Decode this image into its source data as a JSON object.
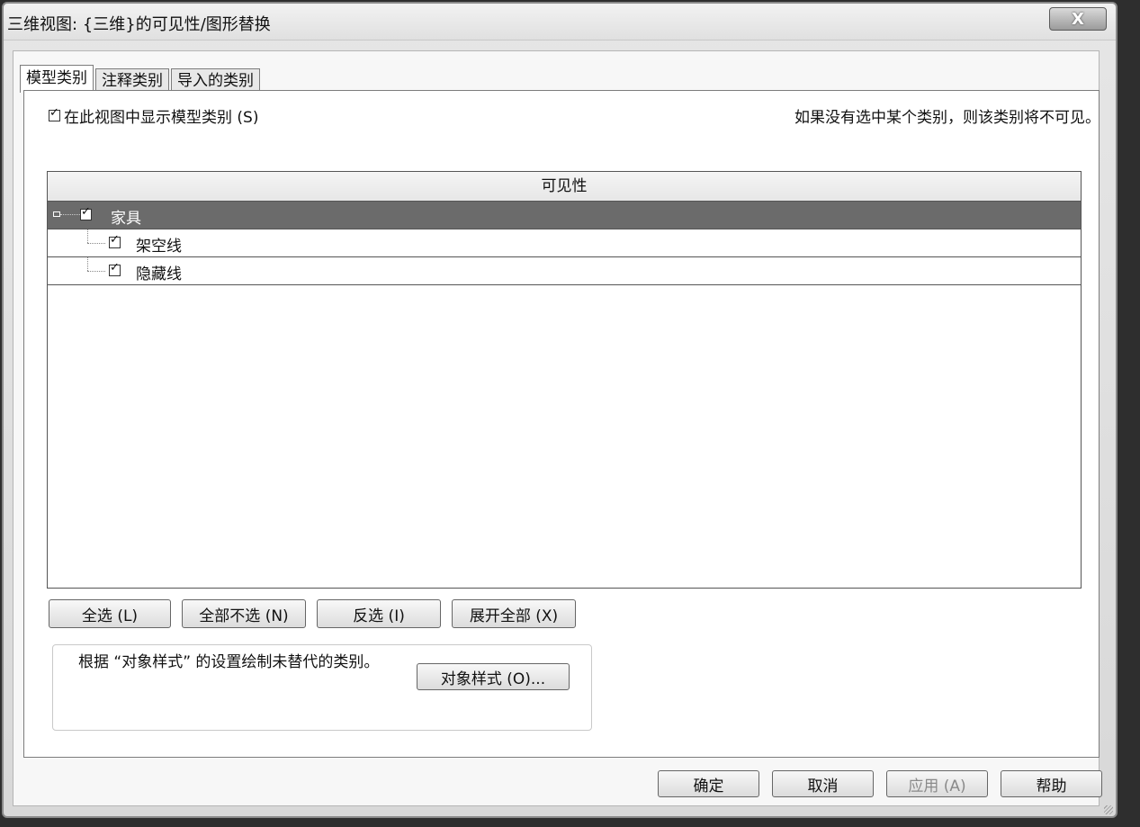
{
  "window": {
    "title": "三维视图: {三维}的可见性/图形替换",
    "close_glyph": "X"
  },
  "tabs": [
    {
      "label": "模型类别",
      "active": true
    },
    {
      "label": "注释类别",
      "active": false
    },
    {
      "label": "导入的类别",
      "active": false
    }
  ],
  "show_model_categories": {
    "label": "在此视图中显示模型类别 (S)",
    "checked": true
  },
  "info_text": "如果没有选中某个类别，则该类别将不可见。",
  "grid": {
    "header": "可见性",
    "rows": [
      {
        "label": "家具",
        "checked": true,
        "selected": true,
        "expanded": true
      },
      {
        "label": "架空线",
        "checked": true
      },
      {
        "label": "隐藏线",
        "checked": true
      }
    ]
  },
  "buttons": {
    "select_all": "全选 (L)",
    "select_none": "全部不选 (N)",
    "invert": "反选 (I)",
    "expand_all": "展开全部 (X)"
  },
  "object_styles": {
    "description": "根据 “对象样式” 的设置绘制未替代的类别。",
    "button": "对象样式 (O)..."
  },
  "footer": {
    "ok": "确定",
    "cancel": "取消",
    "apply": "应用 (A)",
    "help": "帮助"
  }
}
